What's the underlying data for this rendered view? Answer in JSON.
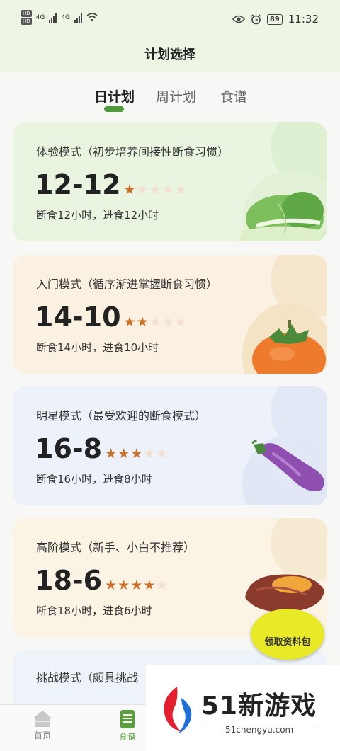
{
  "status_bar": {
    "hd1": "HD",
    "hd2": "HD",
    "net1": "4G",
    "net2": "4G",
    "battery": "89",
    "time": "11:32"
  },
  "header": {
    "title": "计划选择"
  },
  "tabs": [
    {
      "label": "日计划",
      "active": true
    },
    {
      "label": "周计划",
      "active": false
    },
    {
      "label": "食谱",
      "active": false
    }
  ],
  "plans": [
    {
      "title": "体验模式（初步培养间接性断食习惯）",
      "ratio": "12-12",
      "stars_filled": 1,
      "stars_total": 5,
      "desc": "断食12小时，进食12小时",
      "bg": "#eaf5e1",
      "illustration": "bok-choy"
    },
    {
      "title": "入门模式（循序渐进掌握断食习惯）",
      "ratio": "14-10",
      "stars_filled": 2,
      "stars_total": 5,
      "desc": "断食14小时，进食10小时",
      "bg": "#fbf1e2",
      "illustration": "persimmon"
    },
    {
      "title": "明星模式（最受欢迎的断食模式）",
      "ratio": "16-8",
      "stars_filled": 3,
      "stars_total": 5,
      "desc": "断食16小时，进食8小时",
      "bg": "#edf1f9",
      "illustration": "eggplant"
    },
    {
      "title": "高阶模式（新手、小白不推荐）",
      "ratio": "18-6",
      "stars_filled": 4,
      "stars_total": 5,
      "desc": "断食18小时，进食6小时",
      "bg": "#fbf3e4",
      "illustration": "sweet-potato"
    },
    {
      "title": "挑战模式（颇具挑战",
      "bg": "#eef3f9"
    }
  ],
  "promo": {
    "label": "领取资料包"
  },
  "bottom_nav": [
    {
      "label": "首页",
      "icon": "home-icon",
      "active": false
    },
    {
      "label": "食谱",
      "icon": "document-icon",
      "active": true
    }
  ],
  "watermark": {
    "title": "51新游戏",
    "url": "51chengyu.com"
  },
  "colors": {
    "accent": "#4e9a3c",
    "star_on": "#c9702a",
    "star_off": "#f3dfcf"
  }
}
